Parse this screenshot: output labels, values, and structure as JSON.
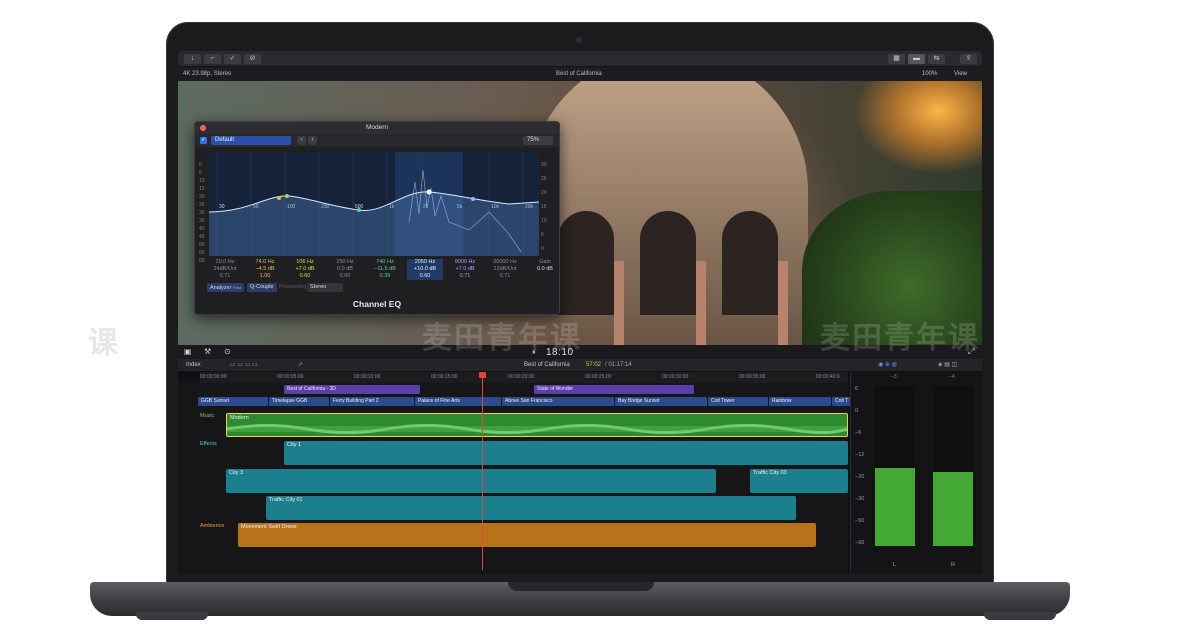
{
  "toolbar": {
    "buttons": [
      "↓",
      "⌐",
      "✓",
      "⊘"
    ],
    "right_buttons": [
      "▦",
      "▬",
      "⇆",
      "⇪"
    ]
  },
  "infobar": {
    "format": "4K 23.98p, Stereo",
    "project": "Best of California",
    "zoom": "100%",
    "view": "View"
  },
  "eq": {
    "window_title": "Modern",
    "preset": "Default",
    "zoom": "75%",
    "plugin_name": "Channel EQ",
    "db_left_scale": [
      "0",
      "5",
      "10",
      "15",
      "20",
      "25",
      "30",
      "35",
      "40",
      "45",
      "50",
      "55",
      "60"
    ],
    "db_right_scale": [
      "30",
      "25",
      "20",
      "15",
      "10",
      "5",
      "0"
    ],
    "freq_labels": [
      "30",
      "50",
      "100",
      "200",
      "500",
      "1k",
      "2k",
      "5k",
      "10k",
      "20k"
    ],
    "bands": [
      {
        "freq": "20.0 Hz",
        "gain": "24dB/Oct",
        "q": "0.71"
      },
      {
        "freq": "74.0 Hz",
        "gain": "−4.5 dB",
        "q": "1.00"
      },
      {
        "freq": "106 Hz",
        "gain": "+7.0 dB",
        "q": "0.60"
      },
      {
        "freq": "250 Hz",
        "gain": "0.0 dB",
        "q": "0.60"
      },
      {
        "freq": "740 Hz",
        "gain": "−11.5 dB",
        "q": "0.39"
      },
      {
        "freq": "2050 Hz",
        "gain": "+10.0 dB",
        "q": "0.60"
      },
      {
        "freq": "9000 Hz",
        "gain": "+7.0 dB",
        "q": "0.71"
      },
      {
        "freq": "20000 Hz",
        "gain": "12dB/Oct",
        "q": "0.71"
      }
    ],
    "gain_label": "Gain",
    "gain_value": "0.0 dB",
    "analyzer": "Analyzer",
    "analyzer_mode": "Post",
    "qcouple": "Q-Couple",
    "processing_label": "Processing",
    "processing": "Stereo"
  },
  "viewer": {
    "timecode": "18:10",
    "pause_icon": "⏸"
  },
  "timeline": {
    "index_label": "Index",
    "project": "Best of California",
    "position": "57:02",
    "duration": "01:17:14",
    "ruler": [
      "00:00:00:00",
      "00:00:05:00",
      "00:00:10:00",
      "00:00:15:00",
      "00:00:20:00",
      "00:00:25:00",
      "00:00:30:00",
      "00:00:35:00",
      "00:00:40:0"
    ],
    "titles": [
      {
        "name": "Best of California - 3D"
      },
      {
        "name": "State of Wonder"
      }
    ],
    "storyline": [
      "GGB Sunset",
      "Timelapse GGB",
      "Ferry Building Part 2",
      "Palace of Fine Arts",
      "Above San Francisco",
      "Bay Bridge Sunset",
      "Coit Tower",
      "Rainbow",
      "Coit T"
    ],
    "roles": {
      "music": "Music",
      "effects": "Effects",
      "ambience": "Ambience"
    },
    "clips": {
      "music": "Modern",
      "city1": "City 1",
      "city3": "City 3",
      "traffic03": "Traffic City 03",
      "traffic01": "Traffic City 01",
      "drone": "Movement Swirl Drone"
    }
  },
  "meters": {
    "scale": [
      "6",
      "0",
      "−6",
      "−12",
      "−20",
      "−30",
      "−50",
      "−60"
    ],
    "channels": [
      {
        "label": "L",
        "level": 0.49
      },
      {
        "label": "R",
        "level": 0.46
      }
    ],
    "peak": [
      "−3",
      "−4"
    ]
  },
  "watermark": {
    "text": "麦田青年课"
  },
  "colors": {
    "accent": "#2f6fe0",
    "music": "#3faa3a",
    "effects": "#1f8fa0",
    "ambience": "#d98a1a",
    "titles": "#6a43b5"
  }
}
